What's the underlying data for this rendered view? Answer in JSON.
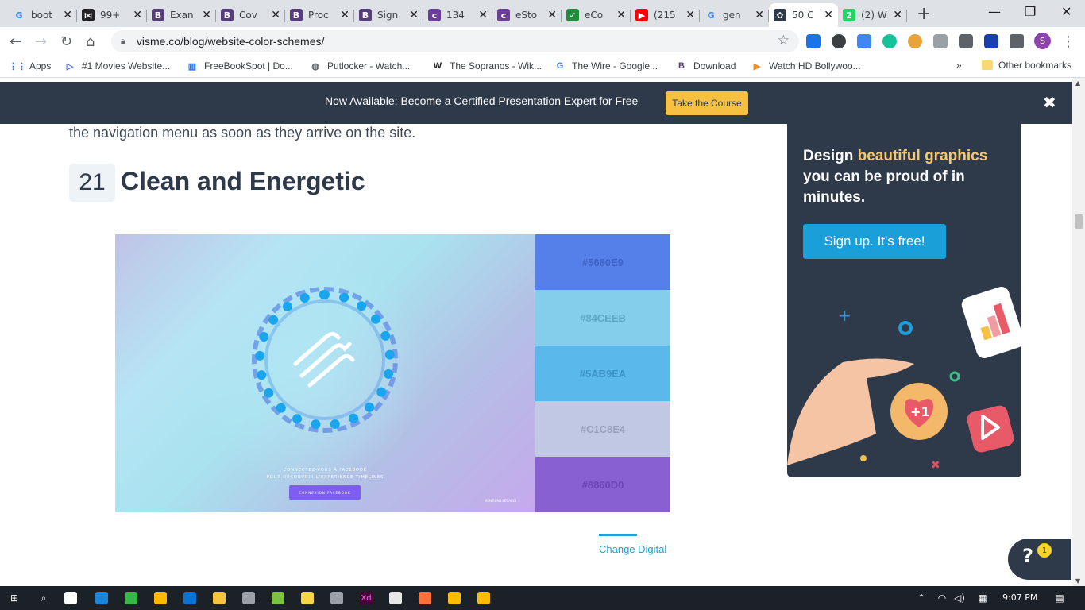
{
  "browser": {
    "tabs": [
      {
        "title": "boot",
        "icon": "google-icon",
        "color": "#4285f4",
        "glyph": "G"
      },
      {
        "title": "99+",
        "icon": "bowtie-icon",
        "color": "#202124",
        "glyph": "⋈"
      },
      {
        "title": "Exan",
        "icon": "bootstrap-icon",
        "color": "#563d7c",
        "glyph": "B"
      },
      {
        "title": "Cov",
        "icon": "bootstrap-icon",
        "color": "#563d7c",
        "glyph": "B"
      },
      {
        "title": "Proc",
        "icon": "bootstrap-icon",
        "color": "#563d7c",
        "glyph": "B"
      },
      {
        "title": "Sign",
        "icon": "bootstrap-icon",
        "color": "#563d7c",
        "glyph": "B"
      },
      {
        "title": "134",
        "icon": "colorlib-icon",
        "color": "#6a3d9a",
        "glyph": "c"
      },
      {
        "title": "eSto",
        "icon": "colorlib-icon",
        "color": "#6a3d9a",
        "glyph": "c"
      },
      {
        "title": "eCo",
        "icon": "check-circle-icon",
        "color": "#1e8e3e",
        "glyph": "✓"
      },
      {
        "title": "(215",
        "icon": "youtube-icon",
        "color": "#ff0000",
        "glyph": "▶"
      },
      {
        "title": "gen",
        "icon": "google-icon",
        "color": "#4285f4",
        "glyph": "G"
      },
      {
        "title": "50 C",
        "icon": "visme-icon",
        "color": "#2e3a49",
        "glyph": "✿"
      },
      {
        "title": "(2) W",
        "icon": "whatsapp-icon",
        "color": "#25d366",
        "glyph": "2"
      }
    ],
    "new_tab_label": "+",
    "minimize": "—",
    "maximize": "❐",
    "close": "✕",
    "url": "visme.co/blog/website-color-schemes/",
    "bookmarks": [
      {
        "label": "Apps",
        "icon": "apps-grid-icon",
        "color": "#1a73e8",
        "glyph": "⋮⋮"
      },
      {
        "label": "#1 Movies Website...",
        "icon": "play-outline-icon",
        "color": "#4a6cf7",
        "glyph": "▷"
      },
      {
        "label": "FreeBookSpot | Do...",
        "icon": "book-icon",
        "color": "#1a73e8",
        "glyph": "▥"
      },
      {
        "label": "Putlocker - Watch...",
        "icon": "globe-icon",
        "color": "#5f6368",
        "glyph": "◍"
      },
      {
        "label": "The Sopranos - Wik...",
        "icon": "wikipedia-icon",
        "color": "#202124",
        "glyph": "W"
      },
      {
        "label": "The Wire - Google...",
        "icon": "google-icon",
        "color": "#4285f4",
        "glyph": "G"
      },
      {
        "label": "Download",
        "icon": "bootstrap-icon",
        "color": "#563d7c",
        "glyph": "B"
      },
      {
        "label": "Watch HD Bollywoo...",
        "icon": "play-circle-icon",
        "color": "#f28b22",
        "glyph": "▶"
      }
    ],
    "bookmarks_overflow": "»",
    "other_bookmarks": "Other bookmarks"
  },
  "banner": {
    "text": "Now Available: Become a Certified Presentation Expert for Free",
    "button": "Take the Course",
    "close": "✖"
  },
  "article": {
    "prev_line": "the navigation menu as soon as they arrive on the site.",
    "section_number": "21",
    "section_title": "Clean and Energetic",
    "hero_text_line1": "CONNECTEZ-VOUS À FACEBOOK",
    "hero_text_line2": "POUR DÉCOUVRIR L'EXPÉRIENCE TIMELINES",
    "hero_button": "CONNEXION FACEBOOK",
    "hero_corner": "MENTIONS LÉGALES",
    "swatches": [
      {
        "hex": "#5680E9",
        "text_color": "#3f63c4"
      },
      {
        "hex": "#84CEEB",
        "text_color": "#5fa8c6"
      },
      {
        "hex": "#5AB9EA",
        "text_color": "#3c95c6"
      },
      {
        "hex": "#C1C8E4",
        "text_color": "#9aa1bd"
      },
      {
        "hex": "#8860D0",
        "text_color": "#6d45b3"
      }
    ],
    "credit": "Change Digital"
  },
  "sidebar_ad": {
    "title_pre": "Design ",
    "title_highlight": "beautiful graphics",
    "title_post": " you can be proud of in minutes.",
    "button": "Sign up. It's free!",
    "badge": "+1"
  },
  "help": {
    "glyph": "?",
    "badge": "1"
  },
  "taskbar": {
    "time": "9:07 PM",
    "icons": [
      "windows-start-icon",
      "search-icon",
      "task-view-icon",
      "edge-icon",
      "refresh-app-icon",
      "store-icon",
      "mail-icon",
      "file-explorer-icon",
      "calculator-icon",
      "android-icon",
      "sticky-notes-icon",
      "clock-app-icon",
      "adobe-xd-icon",
      "paint-icon",
      "firefox-icon",
      "chrome-icon",
      "chrome-icon-2"
    ],
    "xd_label": "Xd"
  }
}
